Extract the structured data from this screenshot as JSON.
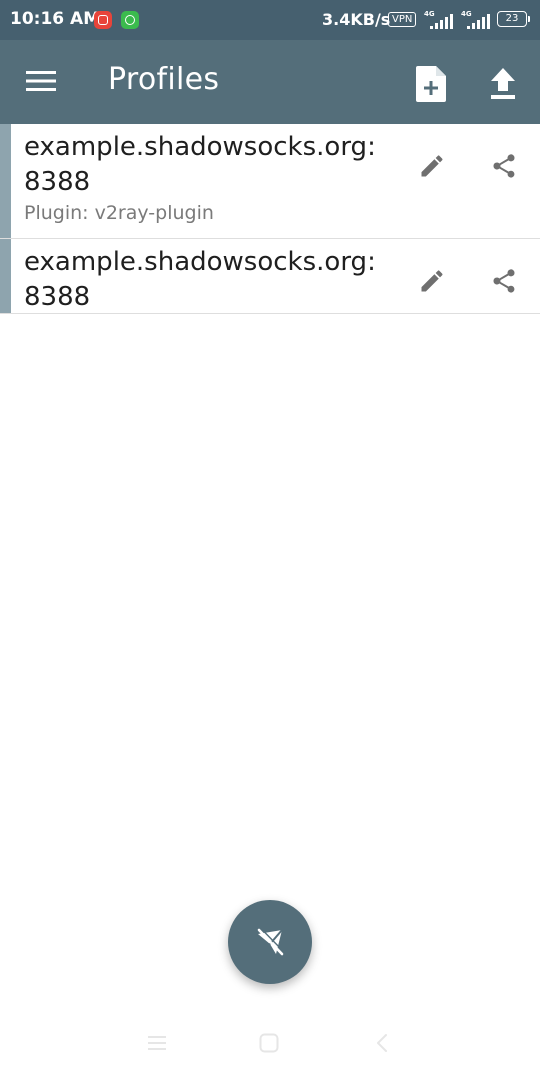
{
  "status_bar": {
    "time": "10:16 AM",
    "speed": "3.4KB/s",
    "vpn": "VPN",
    "network1": "4G",
    "network2": "4G",
    "battery": "23"
  },
  "app_bar": {
    "title": "Profiles",
    "icons": [
      "menu-icon",
      "add-file-icon",
      "upload-icon"
    ]
  },
  "profiles": [
    {
      "name": "example.shadowsocks.org:\n8388",
      "plugin": "Plugin: v2ray-plugin"
    },
    {
      "name": "example.shadowsocks.org:\n8388",
      "plugin": ""
    }
  ],
  "fab": {
    "icon": "airplane-off-icon"
  },
  "colors": {
    "status_bar": "#46606f",
    "primary": "#546e7a",
    "accent_strip": "#8ea4ae",
    "icon_gray": "#6f6f6f",
    "text_primary": "#1f1f1f",
    "text_secondary": "#7a7a7a"
  }
}
